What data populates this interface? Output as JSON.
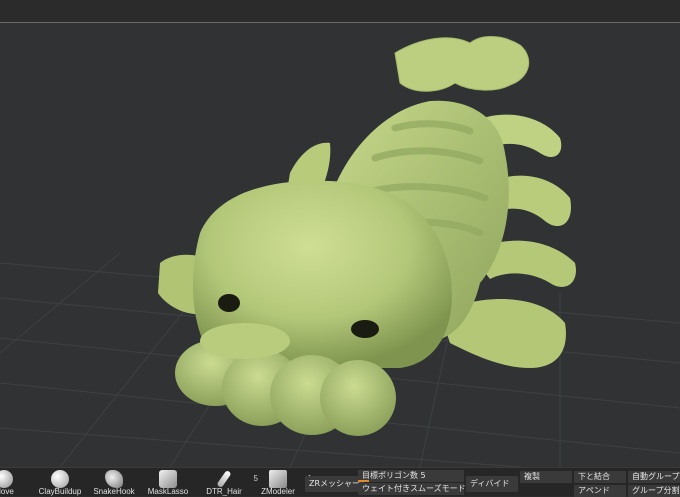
{
  "shelf": {
    "brushes": [
      {
        "label": "Move",
        "count": ""
      },
      {
        "label": "ClayBuildup",
        "count": ""
      },
      {
        "label": "SnakeHook",
        "count": ""
      },
      {
        "label": "MaskLasso",
        "count": ""
      },
      {
        "label": "DTR_Hair",
        "count": "5"
      },
      {
        "label": "ZModeler",
        "count": "1"
      }
    ],
    "zremesher_label": "ZRメッシャー",
    "target_polygons_label": "目標ポリゴン数",
    "target_polygons_value": "5",
    "target_polygons_fraction": 0.1,
    "weighted_smooth_label": "ウェイト付きスムーズモード",
    "weighted_smooth_value": "0",
    "divide_label": "ディバイド",
    "duplicate_label": "複製",
    "merge_down_label": "下と結合",
    "auto_group_label": "自動グループ",
    "append_label": "アペンド",
    "group_split_label": "グループ分割"
  },
  "colors": {
    "background": "#303233",
    "model": "#b9cc7e",
    "slider_accent": "#e08a2c"
  }
}
